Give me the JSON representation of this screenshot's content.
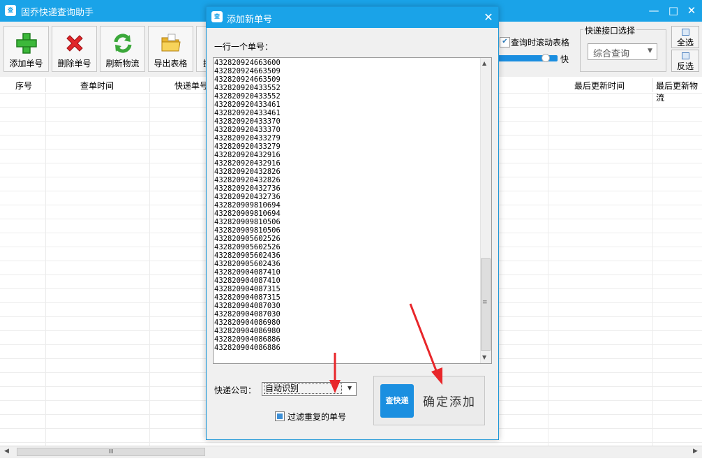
{
  "colors": {
    "titlebar": "#1aa3e8",
    "accent_blue": "#1b8fe0",
    "annotation_red": "#e8262a"
  },
  "app": {
    "logo_text": "查",
    "title": "固乔快递查询助手",
    "controls": {
      "minimize": "—",
      "maximize": "□",
      "close": "✕"
    }
  },
  "toolbar": {
    "buttons": [
      {
        "label": "添加单号",
        "icon": "plus-icon"
      },
      {
        "label": "删除单号",
        "icon": "delete-x-icon"
      },
      {
        "label": "刷新物流",
        "icon": "refresh-icon"
      },
      {
        "label": "导出表格",
        "icon": "folder-icon"
      },
      {
        "label": "提",
        "icon": "partial-icon"
      }
    ],
    "scroll_toggle": {
      "label": "查询时滚动表格",
      "checked": true,
      "check_glyph": "✔"
    },
    "speed": {
      "fast_label": "快",
      "level": 0.8
    },
    "api_group": {
      "title": "快递接口选择",
      "selected": "综合查询"
    },
    "select_all": "全选",
    "invert": "反选"
  },
  "table": {
    "headers": [
      "序号",
      "查单时间",
      "快递单号",
      "最后更新时间",
      "最后更新物流"
    ]
  },
  "hscroll": {
    "grip": "III",
    "left": "◀",
    "right": "▶"
  },
  "dialog": {
    "logo_text": "查",
    "title": "添加新单号",
    "close": "✕",
    "prompt": "一行一个单号：",
    "tracking_numbers": [
      "432820924663600",
      "432820924663509",
      "432820924663509",
      "432820920433552",
      "432820920433552",
      "432820920433461",
      "432820920433461",
      "432820920433370",
      "432820920433370",
      "432820920433279",
      "432820920433279",
      "432820920432916",
      "432820920432916",
      "432820920432826",
      "432820920432826",
      "432820920432736",
      "432820920432736",
      "432820909810694",
      "432820909810694",
      "432820909810506",
      "432820909810506",
      "432820905602526",
      "432820905602526",
      "432820905602436",
      "432820905602436",
      "432820904087410",
      "432820904087410",
      "432820904087315",
      "432820904087315",
      "432820904087030",
      "432820904087030",
      "432820904086980",
      "432820904086980",
      "432820904086886",
      "432820904086886"
    ],
    "scroll": {
      "up": "▲",
      "down": "▼",
      "grip": "≡"
    },
    "courier_label": "快递公司：",
    "courier_selected": "自动识别",
    "courier_arrow": "▼",
    "filter_label": "过滤重复的单号",
    "filter_checked": true,
    "confirm_logo": "查快递",
    "confirm_label": "确定添加"
  }
}
